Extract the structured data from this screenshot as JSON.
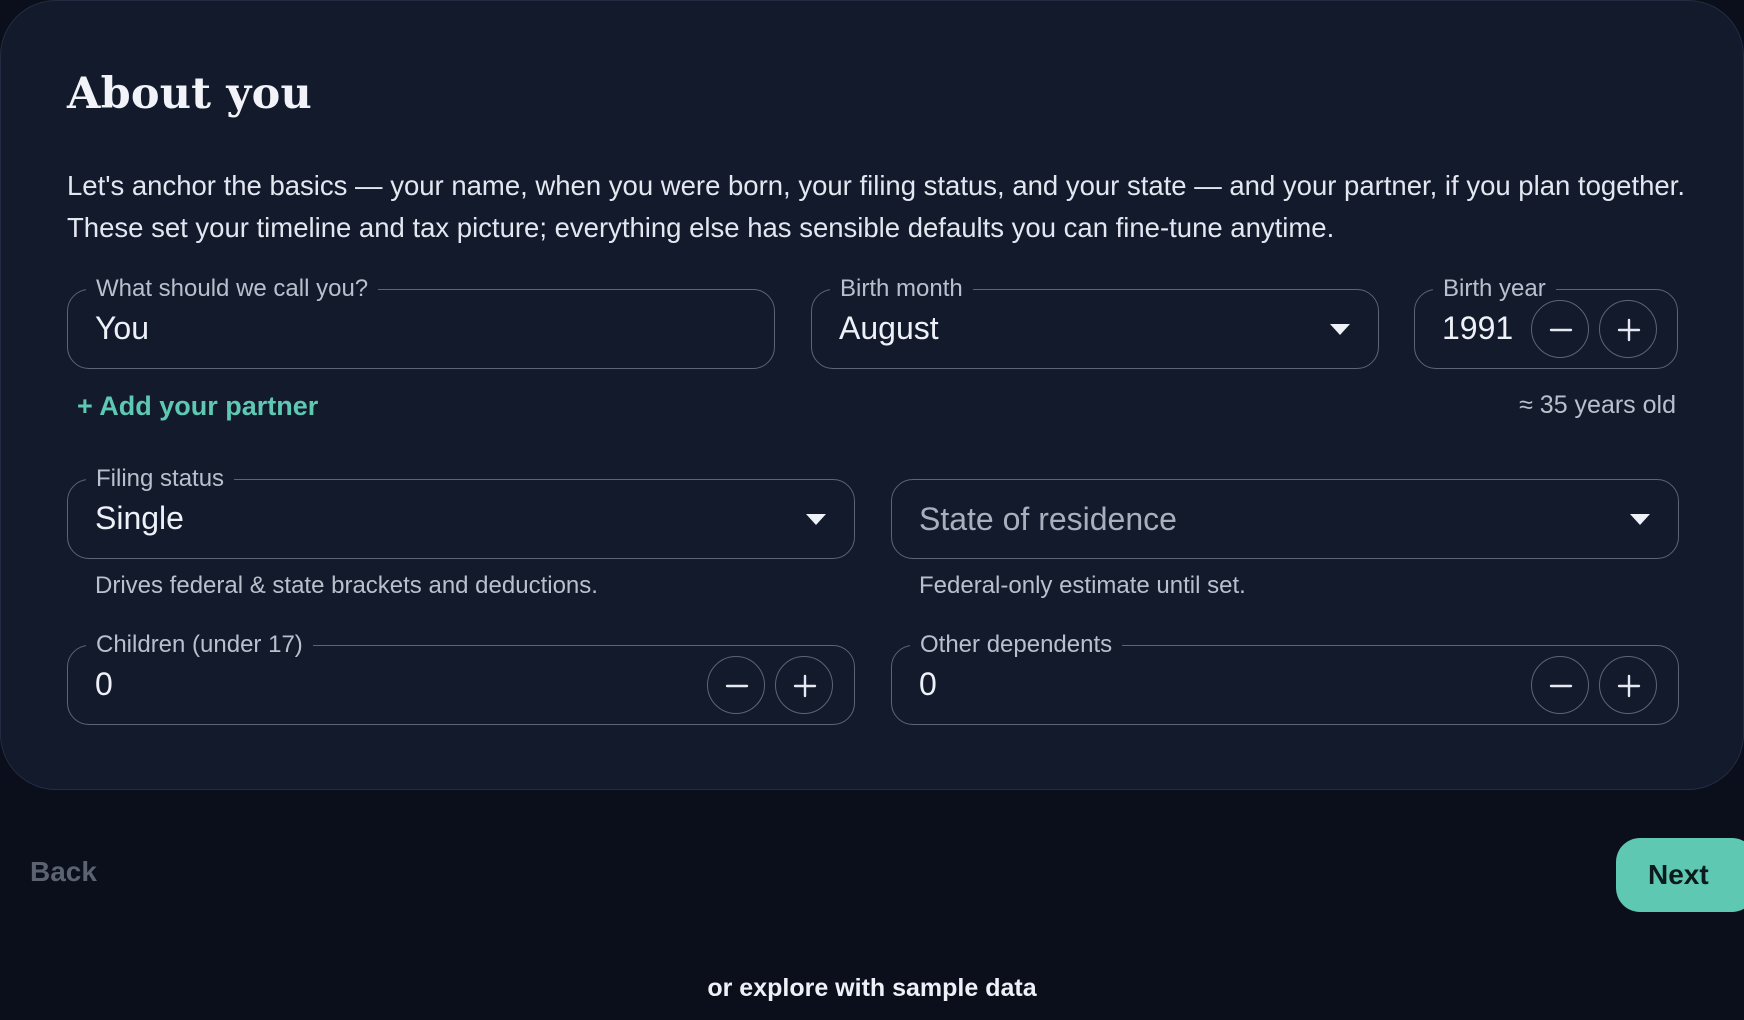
{
  "step": {
    "title": "About you",
    "intro": "Let's anchor the basics — your name, when you were born, your filing status, and your state — and your partner, if you plan together. These set your timeline and tax picture; everything else has sensible defaults you can fine-tune anytime."
  },
  "name_field": {
    "label": "What should we call you?",
    "value": "You"
  },
  "birth_month": {
    "label": "Birth month",
    "value": "August"
  },
  "birth_year": {
    "label": "Birth year",
    "value": "1991"
  },
  "partner": {
    "add_label": "+ Add your partner"
  },
  "age_note": "≈ 35 years old",
  "filing_status": {
    "label": "Filing status",
    "value": "Single",
    "helper": "Drives federal & state brackets and deductions."
  },
  "state": {
    "placeholder": "State of residence",
    "helper": "Federal-only estimate until set."
  },
  "children": {
    "label": "Children (under 17)",
    "value": "0"
  },
  "dependents": {
    "label": "Other dependents",
    "value": "0"
  },
  "nav": {
    "back_label": "Back",
    "next_label": "Next",
    "sample_label": "or explore with sample data"
  },
  "colors": {
    "accent": "#5ec8b3",
    "card_background": "#121a2c",
    "page_background": "#0b0f1b"
  },
  "icons": {
    "dropdown": "chevron-down-icon",
    "decrement": "minus-icon",
    "increment": "plus-icon"
  }
}
